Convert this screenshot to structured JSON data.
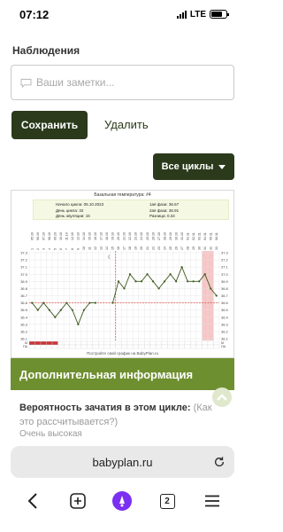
{
  "status_bar": {
    "time": "07:12",
    "network": "LTE"
  },
  "observations": {
    "label": "Наблюдения",
    "notes_placeholder": "Ваши заметки...",
    "save_label": "Сохранить",
    "delete_label": "Удалить",
    "cycles_label": "Все циклы"
  },
  "chart_data": {
    "type": "line",
    "title": "Базальная температура: #4",
    "info": {
      "cycle_start": "Начало цикла: 05.10.2022",
      "cycle_day": "День цикла: 32",
      "ovulation_day": "День овуляции: 15",
      "phase1": "1ая фаза: 36.57",
      "phase2": "2ая фаза: 36.91",
      "difference": "Разница: 0.34"
    },
    "dates": [
      "05.10",
      "06.10",
      "07.10",
      "08.10",
      "09.10",
      "10.10",
      "11.10",
      "12.10",
      "13.10",
      "14.10",
      "15.10",
      "16.10",
      "17.10",
      "18.10",
      "19.10",
      "20.10",
      "21.10",
      "22.10",
      "23.10",
      "24.10",
      "25.10",
      "26.10",
      "27.10",
      "28.10",
      "29.10",
      "30.10",
      "31.10",
      "01.11",
      "02.11",
      "03.11",
      "04.11",
      "05.11",
      "06.11"
    ],
    "days": [
      1,
      2,
      3,
      4,
      5,
      6,
      7,
      8,
      9,
      10,
      11,
      12,
      13,
      14,
      15,
      16,
      17,
      18,
      19,
      20,
      21,
      22,
      23,
      24,
      25,
      26,
      27,
      28,
      29,
      30,
      31,
      32,
      33
    ],
    "y_ticks": [
      "37.3",
      "37.2",
      "37.1",
      "37.0",
      "36.9",
      "36.8",
      "36.7",
      "36.6",
      "36.5",
      "36.4",
      "36.3",
      "36.2",
      "36.1"
    ],
    "ylim": [
      36.1,
      37.3
    ],
    "coverline": 36.6,
    "ovulation_day": 15,
    "highlight_days": [
      31,
      32
    ],
    "menstruation_days": [
      1,
      2,
      3,
      4,
      5
    ],
    "temps": [
      36.6,
      36.5,
      36.6,
      36.5,
      36.4,
      36.5,
      36.6,
      36.5,
      36.3,
      36.5,
      36.6,
      36.6,
      null,
      null,
      36.6,
      36.9,
      36.8,
      37.0,
      36.9,
      36.9,
      37.0,
      36.9,
      36.8,
      36.9,
      37.0,
      36.9,
      37.1,
      36.9,
      36.9,
      36.9,
      37.0,
      36.8,
      36.7
    ],
    "row_labels": [
      "М",
      "ПА"
    ],
    "footer": "Постройте свой график на BabyPlan.ru"
  },
  "additional": {
    "header": "Дополнительная информация",
    "probability_label": "Вероятность зачатия в этом цикле:",
    "probability_link": "(Как это рассчитывается?)",
    "probability_value": "Очень высокая"
  },
  "browser": {
    "url": "babyplan.ru",
    "tab_count": "2"
  },
  "colors": {
    "dark_green": "#2a3a1b",
    "header_green": "#6e8f2f",
    "chart_line": "#3f5a1f",
    "coverline": "#d9342b",
    "ovulation": "#d9342b",
    "highlight": "#f6c6c6",
    "alice_purple": "#7b2ff2"
  }
}
